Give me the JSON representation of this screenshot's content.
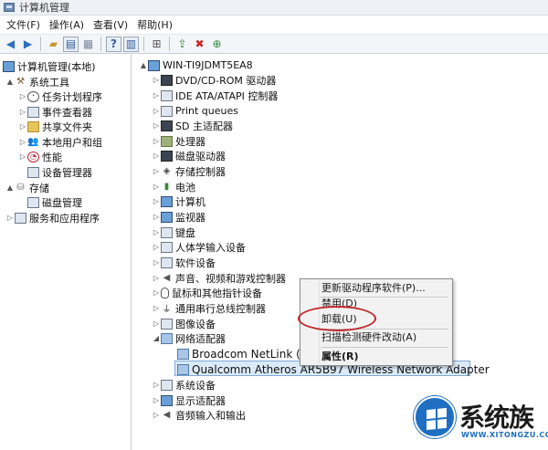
{
  "window": {
    "title": "计算机管理"
  },
  "menu": [
    "文件(F)",
    "操作(A)",
    "查看(V)",
    "帮助(H)"
  ],
  "left_tree": [
    {
      "label": "计算机管理(本地)",
      "icon": "computer-management-icon",
      "arrow": ""
    },
    {
      "label": "系统工具",
      "icon": "tools-icon",
      "arrow": "▲"
    },
    {
      "label": "任务计划程序",
      "icon": "clock-icon",
      "arrow": "▷"
    },
    {
      "label": "事件查看器",
      "icon": "event-viewer-icon",
      "arrow": "▷"
    },
    {
      "label": "共享文件夹",
      "icon": "shared-folder-icon",
      "arrow": "▷"
    },
    {
      "label": "本地用户和组",
      "icon": "users-icon",
      "arrow": "▷"
    },
    {
      "label": "性能",
      "icon": "performance-icon",
      "arrow": "▷"
    },
    {
      "label": "设备管理器",
      "icon": "device-manager-icon",
      "arrow": ""
    },
    {
      "label": "存储",
      "icon": "storage-icon",
      "arrow": "▲"
    },
    {
      "label": "磁盘管理",
      "icon": "disk-management-icon",
      "arrow": ""
    },
    {
      "label": "服务和应用程序",
      "icon": "services-icon",
      "arrow": "▷"
    }
  ],
  "device_tree": {
    "root": "WIN-TI9JDMT5EA8",
    "items": [
      {
        "label": "DVD/CD-ROM 驱动器",
        "icon": "dvd-icon"
      },
      {
        "label": "IDE ATA/ATAPI 控制器",
        "icon": "ide-controller-icon"
      },
      {
        "label": "Print queues",
        "icon": "printer-icon"
      },
      {
        "label": "SD 主适配器",
        "icon": "sd-adapter-icon"
      },
      {
        "label": "处理器",
        "icon": "processor-icon"
      },
      {
        "label": "磁盘驱动器",
        "icon": "disk-drive-icon"
      },
      {
        "label": "存储控制器",
        "icon": "storage-controller-icon"
      },
      {
        "label": "电池",
        "icon": "battery-icon"
      },
      {
        "label": "计算机",
        "icon": "computer-icon"
      },
      {
        "label": "监视器",
        "icon": "monitor-icon"
      },
      {
        "label": "键盘",
        "icon": "keyboard-icon"
      },
      {
        "label": "人体学输入设备",
        "icon": "hid-icon"
      },
      {
        "label": "软件设备",
        "icon": "software-device-icon"
      },
      {
        "label": "声音、视频和游戏控制器",
        "icon": "sound-icon"
      },
      {
        "label": "鼠标和其他指针设备",
        "icon": "mouse-icon"
      },
      {
        "label": "通用串行总线控制器",
        "icon": "usb-icon"
      },
      {
        "label": "图像设备",
        "icon": "imaging-icon"
      },
      {
        "label": "网络适配器",
        "icon": "network-adapter-icon"
      }
    ],
    "network_children": [
      "Broadcom NetLink (T",
      "Qualcomm Atheros AR5B97 Wireless Network Adapter"
    ],
    "after_items": [
      {
        "label": "系统设备",
        "icon": "system-device-icon"
      },
      {
        "label": "显示适配器",
        "icon": "display-adapter-icon"
      },
      {
        "label": "音频输入和输出",
        "icon": "audio-io-icon"
      }
    ]
  },
  "context_menu": {
    "update_driver": "更新驱动程序软件(P)...",
    "disable": "禁用(D)",
    "uninstall": "卸载(U)",
    "scan": "扫描检测硬件改动(A)",
    "properties": "属性(R)"
  },
  "watermark": {
    "brand": "系统族",
    "url": "WWW.XITONGZU.COM"
  }
}
